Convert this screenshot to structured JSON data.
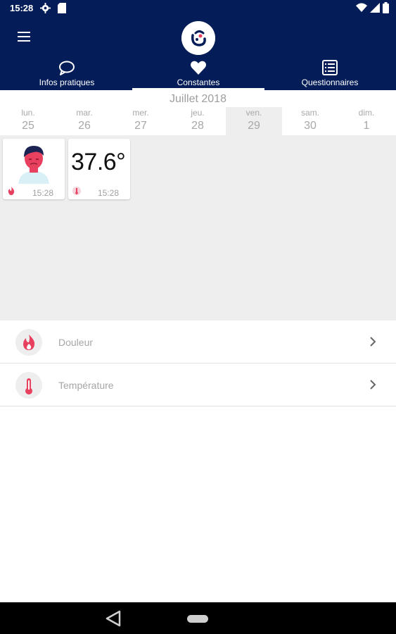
{
  "status_bar": {
    "time": "15:28"
  },
  "header": {
    "menu_icon": "hamburger-menu-icon",
    "logo_icon": "app-logo-icon",
    "tabs": [
      {
        "label": "Infos pratiques",
        "icon": "chat-bubble-icon"
      },
      {
        "label": "Constantes",
        "icon": "heart-icon",
        "selected": true
      },
      {
        "label": "Questionnaires",
        "icon": "list-document-icon"
      }
    ]
  },
  "calendar": {
    "month": "Juillet 2018",
    "days": [
      {
        "name": "lun.",
        "num": "25"
      },
      {
        "name": "mar.",
        "num": "26"
      },
      {
        "name": "mer.",
        "num": "27"
      },
      {
        "name": "jeu.",
        "num": "28"
      },
      {
        "name": "ven.",
        "num": "29",
        "selected": true
      },
      {
        "name": "sam.",
        "num": "30"
      },
      {
        "name": "dim.",
        "num": "1"
      }
    ]
  },
  "cards": {
    "pain": {
      "time": "15:28",
      "icon": "flame-icon"
    },
    "temperature": {
      "value": "37.6°",
      "time": "15:28",
      "icon": "thermometer-icon"
    }
  },
  "measures": [
    {
      "label": "Douleur",
      "icon": "flame-icon"
    },
    {
      "label": "Température",
      "icon": "thermometer-icon"
    }
  ],
  "colors": {
    "primary": "#041c57",
    "accent": "#e8405f",
    "background": "#eeeeee"
  }
}
